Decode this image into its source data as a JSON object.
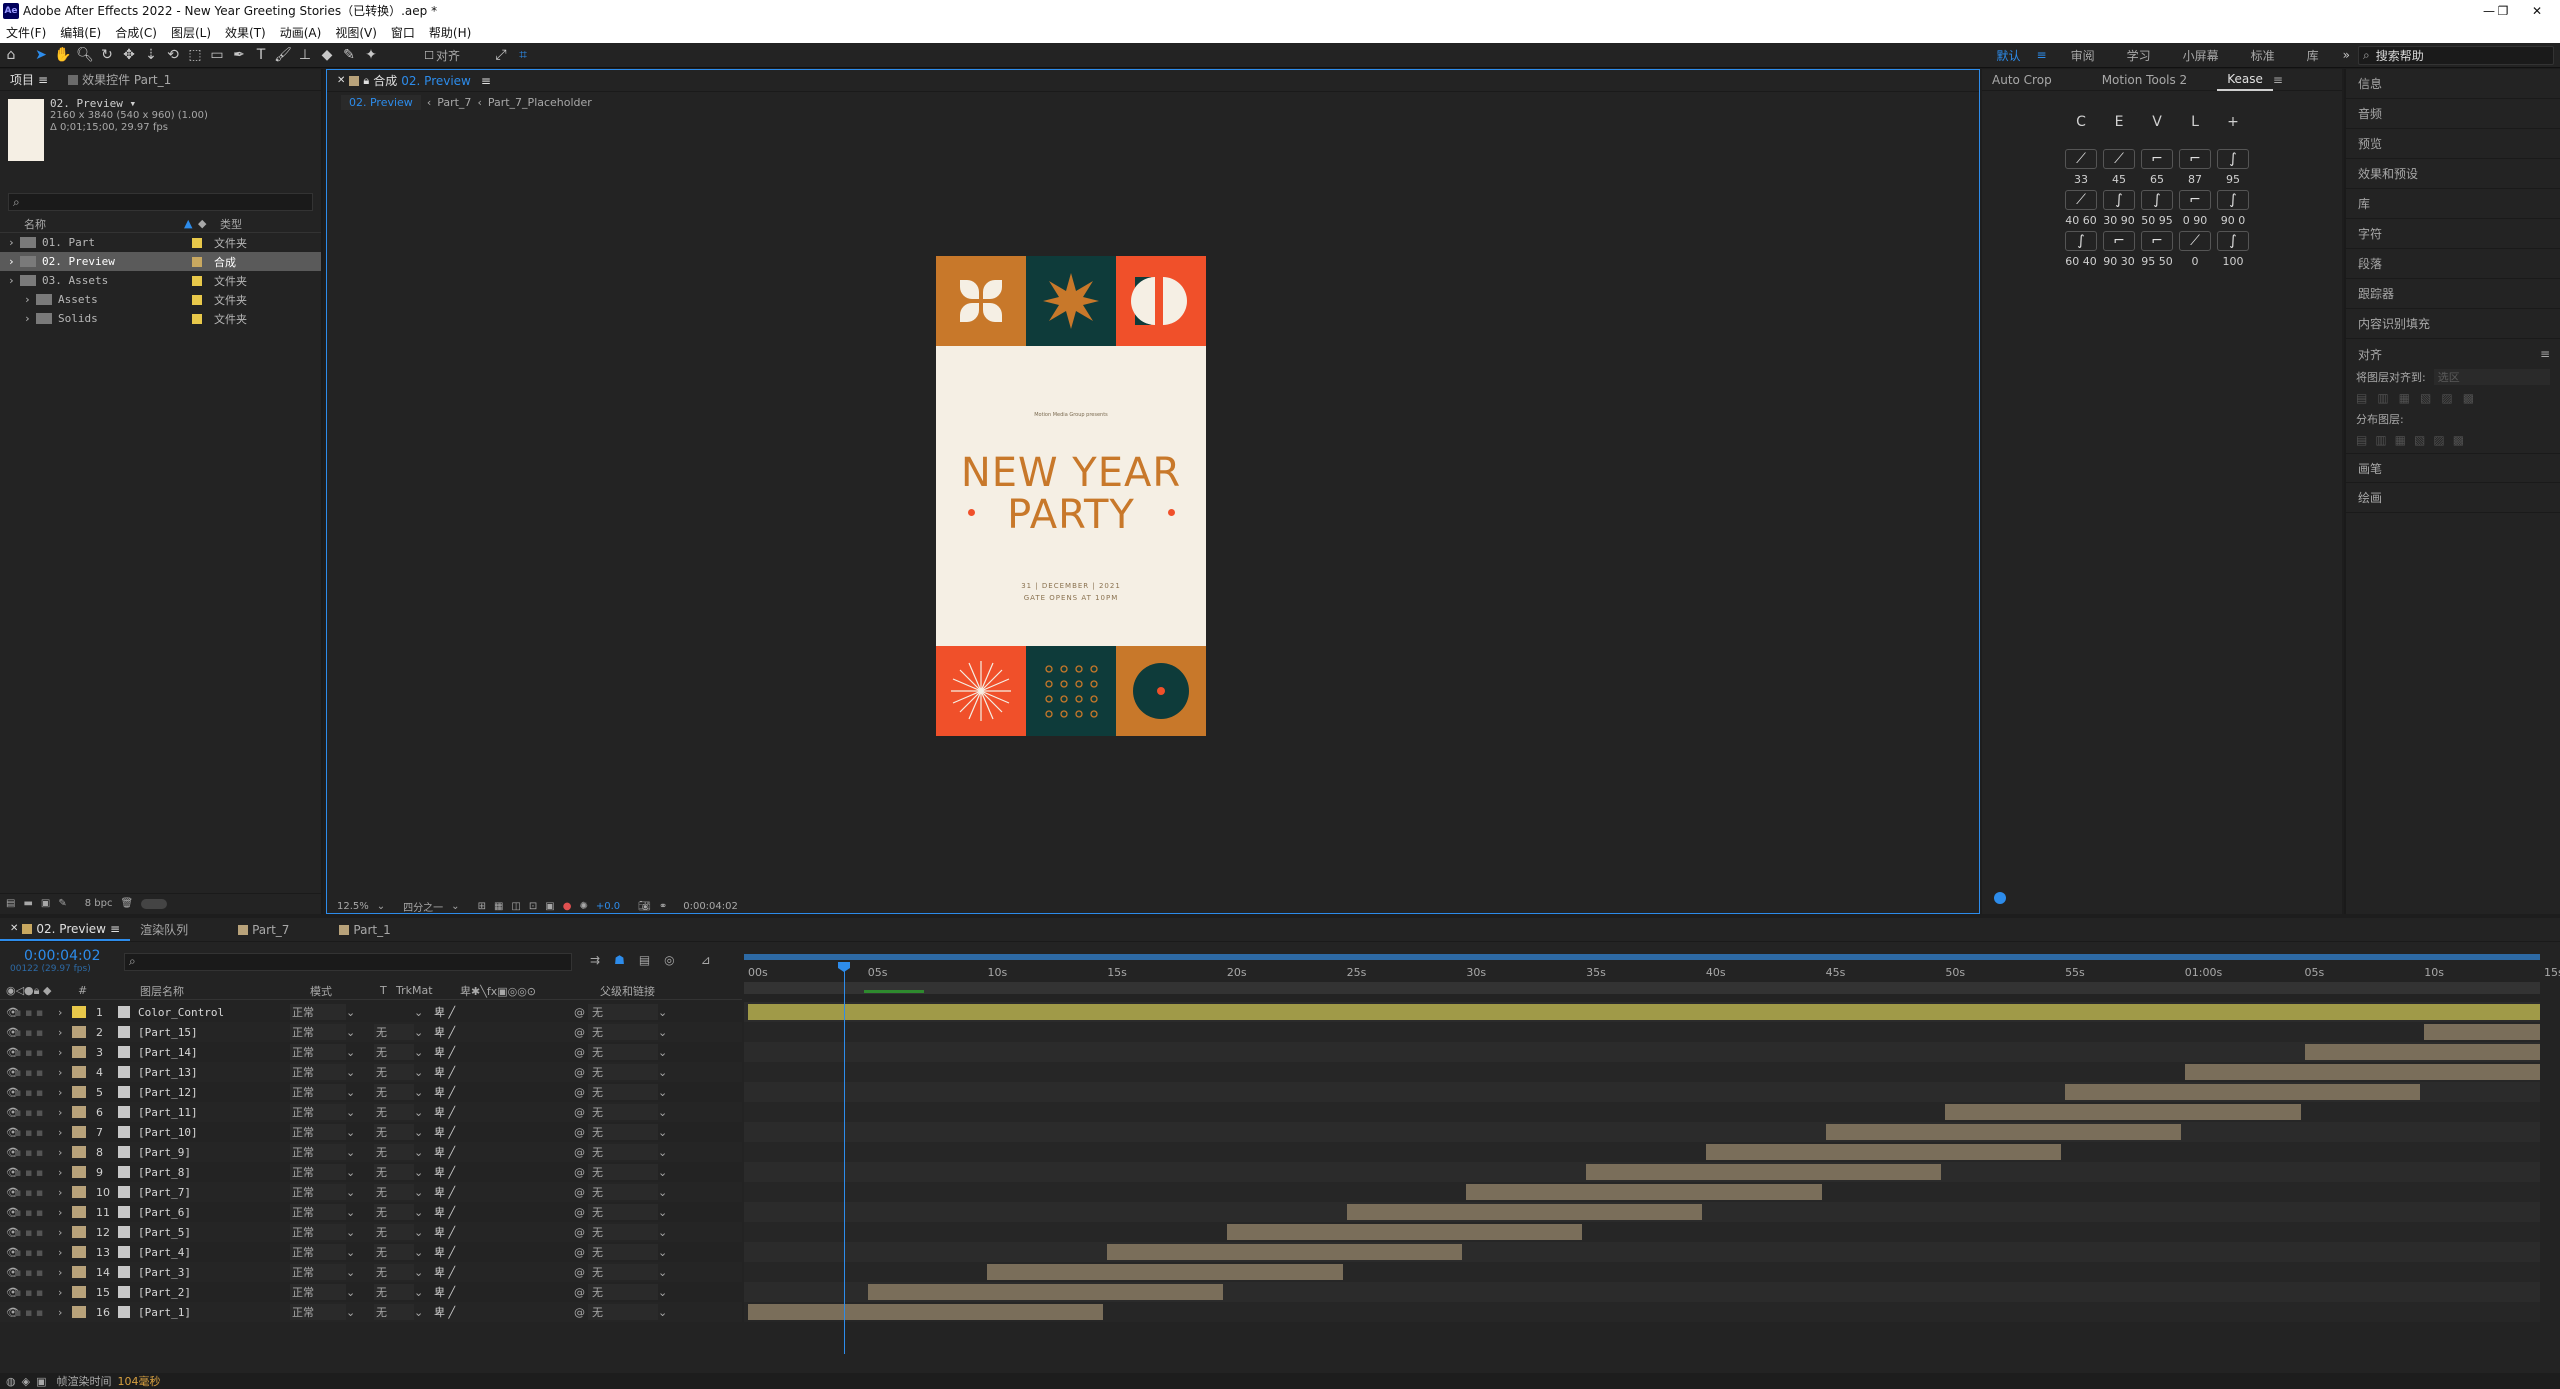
{
  "window": {
    "title": "Adobe After Effects 2022 - New Year Greeting Stories（已转换）.aep *",
    "app_icon": "Ae",
    "min": "—",
    "restore": "❐",
    "close": "✕"
  },
  "menu": [
    "文件(F)",
    "编辑(E)",
    "合成(C)",
    "图层(L)",
    "效果(T)",
    "动画(A)",
    "视图(V)",
    "窗口",
    "帮助(H)"
  ],
  "toolbar": {
    "align_label": "对齐",
    "workspaces": [
      "默认",
      "审阅",
      "学习",
      "小屏幕",
      "标准",
      "库"
    ],
    "active_workspace": "默认",
    "search_placeholder": "搜索帮助"
  },
  "project": {
    "tab_project": "项目",
    "tab_effects": "效果控件 Part_1",
    "comp_name": "02. Preview ▾",
    "comp_size": "2160 x 3840  (540 x 960) (1.00)",
    "comp_duration": "Δ 0;01;15;00, 29.97 fps",
    "col_name": "名称",
    "col_type": "类型",
    "items": [
      {
        "name": "01. Part",
        "type": "文件夹",
        "color": "#e8c84a",
        "indent": 0,
        "selected": false
      },
      {
        "name": "02. Preview",
        "type": "合成",
        "color": "#c8a860",
        "indent": 0,
        "selected": true
      },
      {
        "name": "03. Assets",
        "type": "文件夹",
        "color": "#e8c84a",
        "indent": 0,
        "selected": false
      },
      {
        "name": "Assets",
        "type": "文件夹",
        "color": "#e8c84a",
        "indent": 1,
        "selected": false
      },
      {
        "name": "Solids",
        "type": "文件夹",
        "color": "#e8c84a",
        "indent": 1,
        "selected": false
      }
    ],
    "bpc": "8 bpc"
  },
  "composition": {
    "tab_label": "合成",
    "tab_comp": "02. Preview",
    "breadcrumbs": [
      "02. Preview",
      "Part_7",
      "Part_7_Placeholder"
    ],
    "zoom": "12.5%",
    "resolution": "四分之一",
    "exposure": "+0.0",
    "timecode": "0:00:04:02"
  },
  "poster": {
    "presenter": "Motion Media Group presents",
    "line1": "NEW YEAR",
    "line2": "PARTY",
    "date": "31 | DECEMBER | 2021",
    "gate": "GATE OPENS AT 10PM",
    "orange": "#c8782a",
    "teal": "#0e3b3a",
    "red": "#f0502a",
    "cream": "#f5efe4"
  },
  "kease": {
    "tabs": [
      "Auto Crop",
      "Motion Tools 2",
      "Kease"
    ],
    "letters": [
      "C",
      "E",
      "V",
      "L",
      "+"
    ],
    "rows": [
      [
        "33",
        "45",
        "65",
        "87",
        "95"
      ],
      [
        "40 60",
        "30 90",
        "50 95",
        "0 90",
        "90 0"
      ],
      [
        "60 40",
        "90 30",
        "95 50",
        "0",
        "100"
      ]
    ]
  },
  "right_panel": {
    "items": [
      "信息",
      "音频",
      "预览",
      "效果和预设",
      "库",
      "字符",
      "段落",
      "跟踪器",
      "内容识别填充"
    ],
    "align_title": "对齐",
    "align_to_label": "将图层对齐到:",
    "align_to_value": "选区",
    "distribute_label": "分布图层:",
    "extra": [
      "画笔",
      "绘画"
    ]
  },
  "timeline": {
    "tabs": [
      "02. Preview",
      "渲染队列",
      "Part_7",
      "Part_1"
    ],
    "timecode": "0:00:04:02",
    "frame_info": "00122 (29.97 fps)",
    "headers": {
      "num": "#",
      "name": "图层名称",
      "mode": "模式",
      "t": "T",
      "trkmat": "TrkMat",
      "parent": "父级和链接"
    },
    "ruler": [
      "00s",
      "05s",
      "10s",
      "15s",
      "20s",
      "25s",
      "30s",
      "35s",
      "40s",
      "45s",
      "50s",
      "55s",
      "01:00s",
      "05s",
      "10s",
      "15s"
    ],
    "layers": [
      {
        "num": "1",
        "name": "Color_Control",
        "mode": "正常",
        "trk": "",
        "parent": "无",
        "color": "#e8c84a",
        "start": 0,
        "end": 75
      },
      {
        "num": "2",
        "name": "[Part_15]",
        "mode": "正常",
        "trk": "无",
        "parent": "无",
        "color": "#b8a27a",
        "start": 70,
        "end": 75
      },
      {
        "num": "3",
        "name": "[Part_14]",
        "mode": "正常",
        "trk": "无",
        "parent": "无",
        "color": "#b8a27a",
        "start": 65,
        "end": 75
      },
      {
        "num": "4",
        "name": "[Part_13]",
        "mode": "正常",
        "trk": "无",
        "parent": "无",
        "color": "#b8a27a",
        "start": 60,
        "end": 75
      },
      {
        "num": "5",
        "name": "[Part_12]",
        "mode": "正常",
        "trk": "无",
        "parent": "无",
        "color": "#b8a27a",
        "start": 55,
        "end": 70
      },
      {
        "num": "6",
        "name": "[Part_11]",
        "mode": "正常",
        "trk": "无",
        "parent": "无",
        "color": "#b8a27a",
        "start": 50,
        "end": 65
      },
      {
        "num": "7",
        "name": "[Part_10]",
        "mode": "正常",
        "trk": "无",
        "parent": "无",
        "color": "#b8a27a",
        "start": 45,
        "end": 60
      },
      {
        "num": "8",
        "name": "[Part_9]",
        "mode": "正常",
        "trk": "无",
        "parent": "无",
        "color": "#b8a27a",
        "start": 40,
        "end": 55
      },
      {
        "num": "9",
        "name": "[Part_8]",
        "mode": "正常",
        "trk": "无",
        "parent": "无",
        "color": "#b8a27a",
        "start": 35,
        "end": 50
      },
      {
        "num": "10",
        "name": "[Part_7]",
        "mode": "正常",
        "trk": "无",
        "parent": "无",
        "color": "#b8a27a",
        "start": 30,
        "end": 45
      },
      {
        "num": "11",
        "name": "[Part_6]",
        "mode": "正常",
        "trk": "无",
        "parent": "无",
        "color": "#b8a27a",
        "start": 25,
        "end": 40
      },
      {
        "num": "12",
        "name": "[Part_5]",
        "mode": "正常",
        "trk": "无",
        "parent": "无",
        "color": "#b8a27a",
        "start": 20,
        "end": 35
      },
      {
        "num": "13",
        "name": "[Part_4]",
        "mode": "正常",
        "trk": "无",
        "parent": "无",
        "color": "#b8a27a",
        "start": 15,
        "end": 30
      },
      {
        "num": "14",
        "name": "[Part_3]",
        "mode": "正常",
        "trk": "无",
        "parent": "无",
        "color": "#b8a27a",
        "start": 10,
        "end": 25
      },
      {
        "num": "15",
        "name": "[Part_2]",
        "mode": "正常",
        "trk": "无",
        "parent": "无",
        "color": "#b8a27a",
        "start": 5,
        "end": 20
      },
      {
        "num": "16",
        "name": "[Part_1]",
        "mode": "正常",
        "trk": "无",
        "parent": "无",
        "color": "#b8a27a",
        "start": 0,
        "end": 15
      }
    ],
    "render_label": "帧渲染时间",
    "render_value": "104毫秒"
  }
}
